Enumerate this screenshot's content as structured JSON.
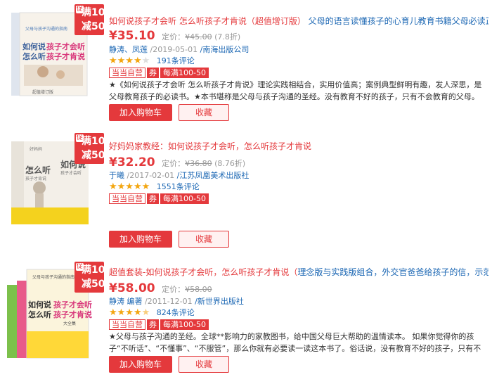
{
  "items": [
    {
      "promo": {
        "tag": "促",
        "line1": "满100",
        "line2": "减50"
      },
      "cover_text": {
        "top": "父母与孩子沟通的指南",
        "title_a": "如何说",
        "title_b": "孩子才会听",
        "title_c": "怎么听",
        "title_d": "孩子才肯说",
        "note": "超值增订版"
      },
      "title_red": "如何说孩子才会听 怎么听孩子才肯说（超值增订版）",
      "title_blue": "父母的语言读懂孩子的心育儿教育书籍父母必读正面管教培养",
      "price": "¥35.10",
      "list_label": "定价：",
      "list_price": "¥45.00",
      "discount": "(7.8折)",
      "author": "静涛、凤莲",
      "date": "/2019-05-01",
      "publisher": "/南海出版公司",
      "stars": 4,
      "reviews": "191条评论",
      "badge_self": "当当自营",
      "badge_coupon": "券",
      "badge_deal": "每满100-50",
      "desc": "★《如何说孩子才会听 怎么听孩子才肯说》理论实践相结合，实用价值高；案例典型鲜明有趣，发人深思，是父母教育孩子的必读书。★本书堪称是父母与孩子沟通的圣经。没有教育不好的孩子，只有不会教育的父母。你的一句话，",
      "cart": "加入购物车",
      "fav": "收藏"
    },
    {
      "promo": {
        "tag": "促",
        "line1": "满100",
        "line2": "减50"
      },
      "cover_text": {
        "top": "好妈妈",
        "title_a": "如何说",
        "title_b": "孩子才会听",
        "title_c": "怎么听",
        "title_d": "孩子才肯说",
        "note": ""
      },
      "title_red": "好妈妈家教经：如何说孩子才会听，怎么听孩子才肯说",
      "title_blue": "",
      "price": "¥32.20",
      "list_label": "定价：",
      "list_price": "¥36.80",
      "discount": "(8.76折)",
      "author": "于曦",
      "date": "/2017-02-01",
      "publisher": "/江苏凤凰美术出版社",
      "stars": 5,
      "reviews": "1551条评论",
      "badge_self": "当当自营",
      "badge_coupon": "券",
      "badge_deal": "每满100-50",
      "desc": "",
      "cart": "加入购物车",
      "fav": "收藏"
    },
    {
      "promo": {
        "tag": "促",
        "line1": "满100",
        "line2": "减50"
      },
      "cover_text": {
        "top": "父母与孩子沟通的指南",
        "title_a": "如何说",
        "title_b": "孩子才会听",
        "title_c": "怎么听",
        "title_d": "孩子才肯说",
        "note": "大全集"
      },
      "title_red": "超值套装-如何说孩子才会听，怎么听孩子才肯说（",
      "title_blue": "理念版与实践版组合，外交官爸爸给孩子的信，示范了与孩子谈",
      "price": "¥58.00",
      "list_label": "定价：",
      "list_price": "¥58.00",
      "discount": "",
      "author": "静涛 编著",
      "date": "/2011-12-01",
      "publisher": "/新世界出版社",
      "stars": 4.5,
      "reviews": "824条评论",
      "badge_self": "当当自营",
      "badge_coupon": "券",
      "badge_deal": "每满100-50",
      "desc": "★父母与孩子沟通的圣经。全球**影响力的家教图书，给中国父母巨大帮助的温情读本。 如果你觉得你的孩子“不听话”、“不懂事”、“不服管”，那么你就有必要读一读这本书了。俗话说，没有教育不好的孩子，只有不会教育的",
      "cart": "加入购物车",
      "fav": "收藏"
    }
  ],
  "colors": {
    "accent": "#e4393c",
    "link": "#1a66b3",
    "star": "#f3a610"
  }
}
